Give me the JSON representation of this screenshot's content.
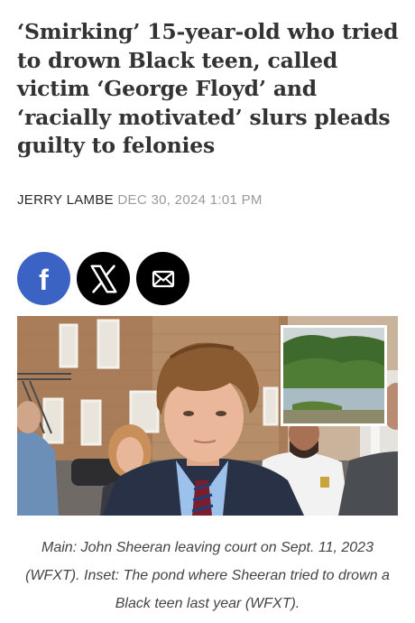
{
  "article": {
    "headline": "‘Smirking’ 15-year-old who tried to drown Black teen, called victim ‘George Floyd’ and ‘racially motivated’ slurs pleads guilty to felonies",
    "author": "JERRY LAMBE",
    "date": "DEC 30, 2024 1:01 PM",
    "caption": "Main: John Sheeran leaving court on Sept. 11, 2023 (WFXT). Inset: The pond where Sheeran tried to drown a Black teen last year (WFXT)."
  },
  "share": {
    "facebook": {
      "icon": "facebook-icon",
      "glyph": "f",
      "color": "#3b63c4"
    },
    "x": {
      "icon": "x-icon",
      "color": "#000000"
    },
    "email": {
      "icon": "mail-icon",
      "color": "#000000"
    }
  }
}
